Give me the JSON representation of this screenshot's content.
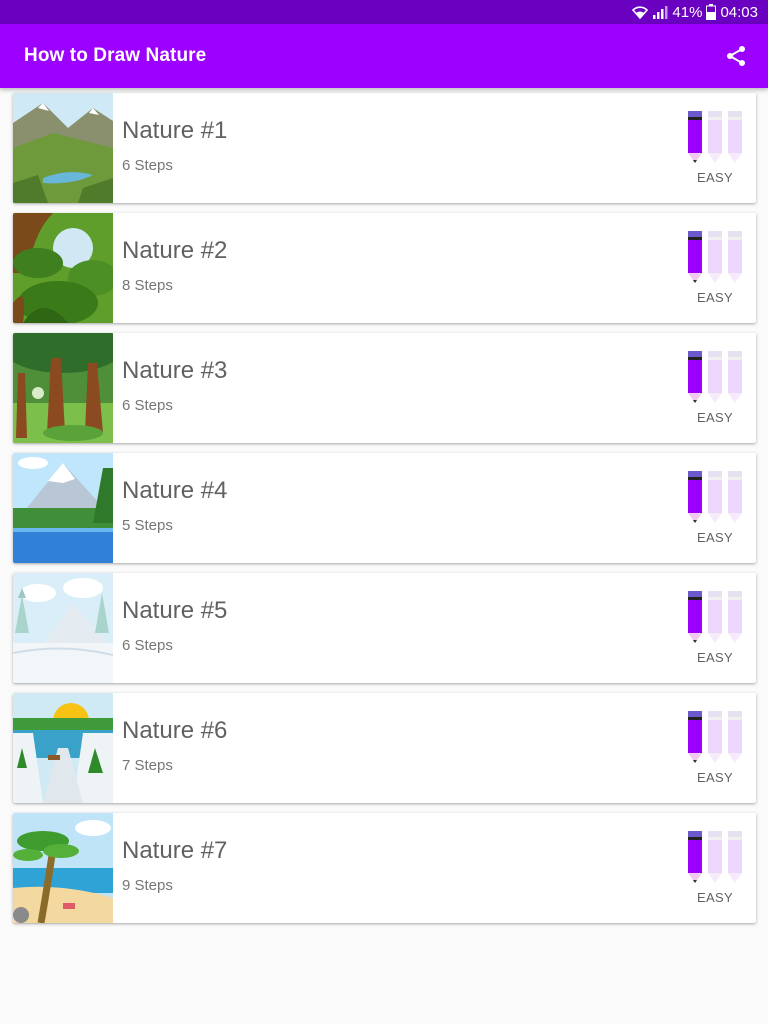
{
  "status_bar": {
    "battery": "41%",
    "time": "04:03"
  },
  "app_bar": {
    "title": "How to Draw Nature"
  },
  "colors": {
    "status_bar": "#6a00c0",
    "app_bar": "#9c00ff",
    "pencil_active": "#9c00ff",
    "pencil_inactive": "#ecd6fb"
  },
  "items": [
    {
      "title": "Nature #1",
      "steps": "6 Steps",
      "difficulty": "EASY",
      "level": 1
    },
    {
      "title": "Nature #2",
      "steps": "8 Steps",
      "difficulty": "EASY",
      "level": 1
    },
    {
      "title": "Nature #3",
      "steps": "6 Steps",
      "difficulty": "EASY",
      "level": 1
    },
    {
      "title": "Nature #4",
      "steps": "5 Steps",
      "difficulty": "EASY",
      "level": 1
    },
    {
      "title": "Nature #5",
      "steps": "6 Steps",
      "difficulty": "EASY",
      "level": 1
    },
    {
      "title": "Nature #6",
      "steps": "7 Steps",
      "difficulty": "EASY",
      "level": 1
    },
    {
      "title": "Nature #7",
      "steps": "9 Steps",
      "difficulty": "EASY",
      "level": 1
    }
  ]
}
